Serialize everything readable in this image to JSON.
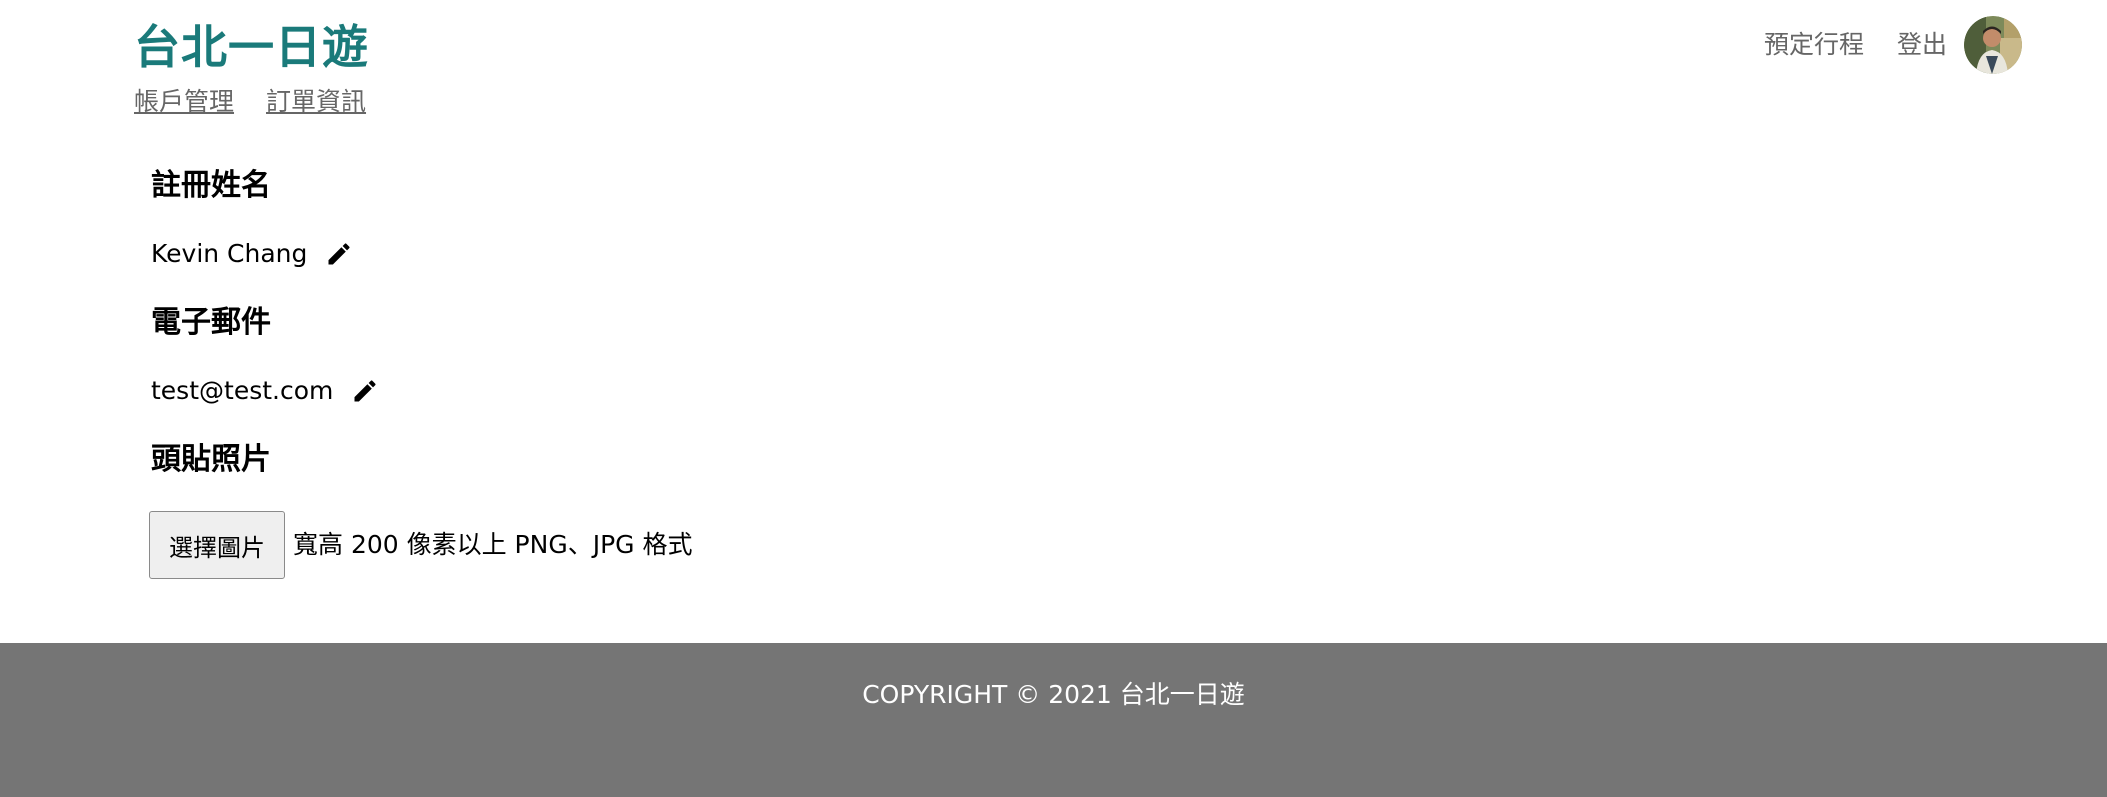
{
  "header": {
    "brand": "台北一日遊",
    "subnav": {
      "account": "帳戶管理",
      "orders": "訂單資訊"
    },
    "topnav": {
      "booking": "預定行程",
      "logout": "登出"
    }
  },
  "profile": {
    "name_label": "註冊姓名",
    "name_value": "Kevin Chang",
    "email_label": "電子郵件",
    "email_value": "test@test.com",
    "photo_label": "頭貼照片",
    "upload_button": "選擇圖片",
    "upload_hint": "寬高 200 像素以上 PNG、JPG 格式"
  },
  "footer": {
    "copyright": "COPYRIGHT © 2021 台北一日遊"
  },
  "colors": {
    "brand": "#1a7a7a",
    "nav_text": "#666666",
    "footer_bg": "#757575"
  },
  "icons": {
    "edit": "pencil-icon",
    "avatar": "user-avatar-photo"
  }
}
